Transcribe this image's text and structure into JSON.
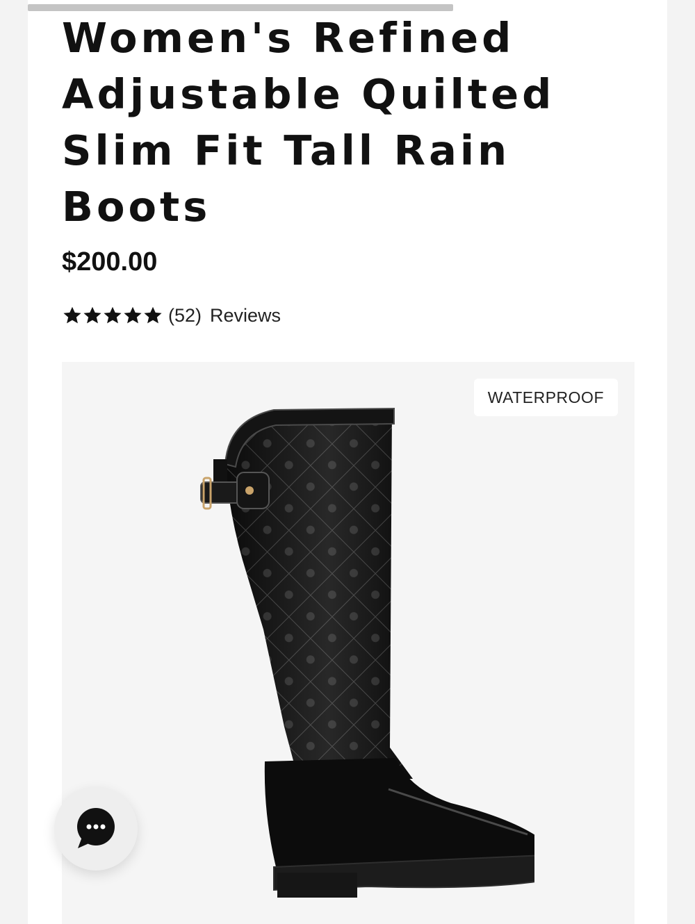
{
  "product": {
    "title": "Women's Refined Adjustable Quilted Slim Fit Tall Rain Boots",
    "price": "$200.00",
    "rating": {
      "stars": 5,
      "max_stars": 5,
      "review_count": "(52)",
      "reviews_label": "Reviews"
    },
    "image": {
      "badge": "WATERPROOF",
      "background_color": "#f5f5f5",
      "subject": "black quilted tall rain boot"
    }
  },
  "chat": {
    "icon": "chat-bubble-ellipsis-icon"
  },
  "colors": {
    "text": "#111111",
    "page_background": "#ffffff",
    "boot": "#0a0a0a"
  }
}
